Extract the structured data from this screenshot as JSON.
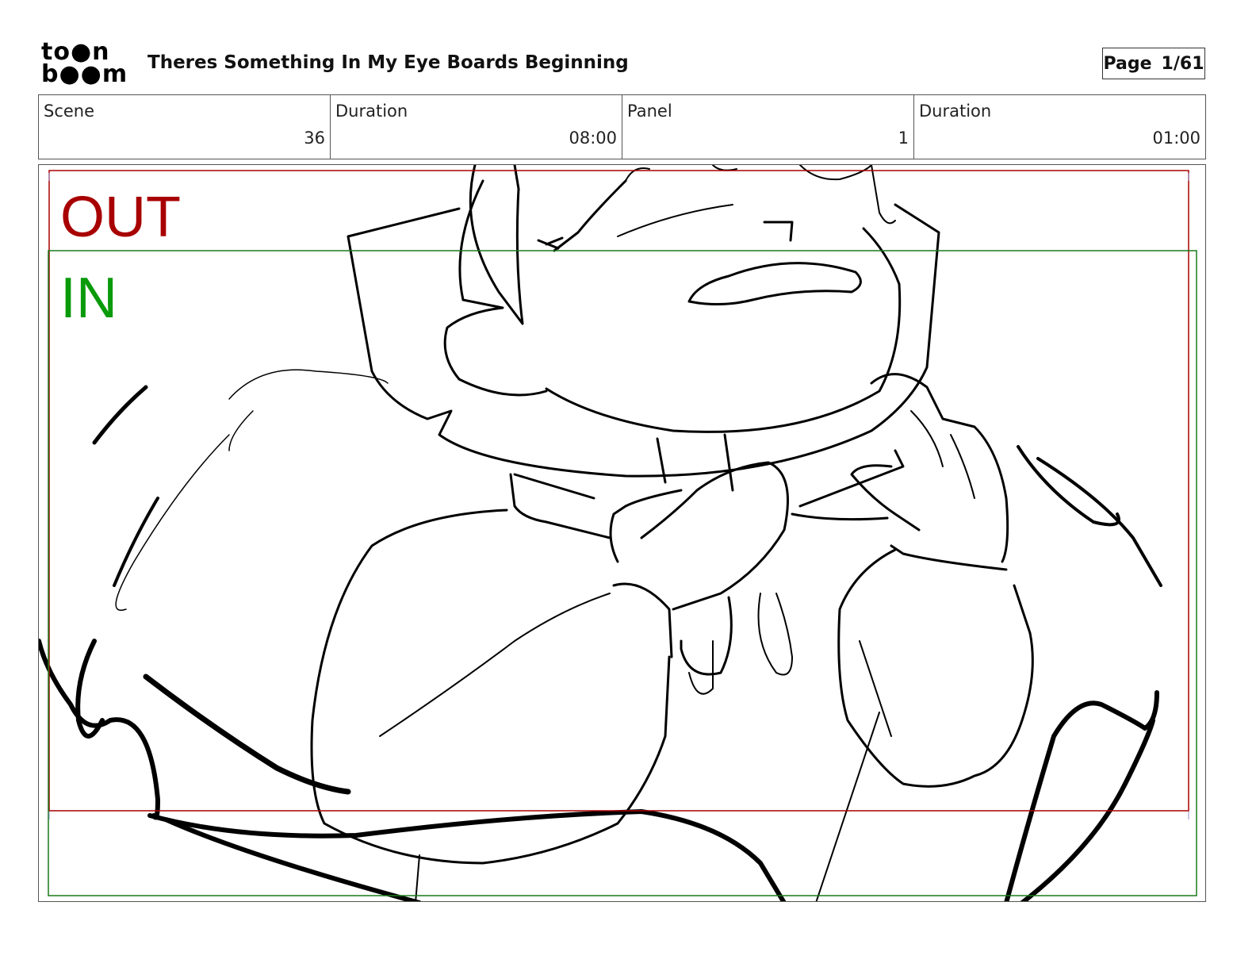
{
  "header": {
    "logo_line1": "to●n",
    "logo_line2": "b●●m",
    "title": "Theres Something In My Eye Boards Beginning",
    "page_label": "Page",
    "page_value": "1/61"
  },
  "info": {
    "scene_label": "Scene",
    "scene_value": "36",
    "scene_duration_label": "Duration",
    "scene_duration_value": "08:00",
    "panel_label": "Panel",
    "panel_value": "1",
    "panel_duration_label": "Duration",
    "panel_duration_value": "01:00"
  },
  "frame": {
    "out_label": "OUT",
    "in_label": "IN",
    "out_color": "#a80000",
    "in_color": "#0a9a0a"
  }
}
